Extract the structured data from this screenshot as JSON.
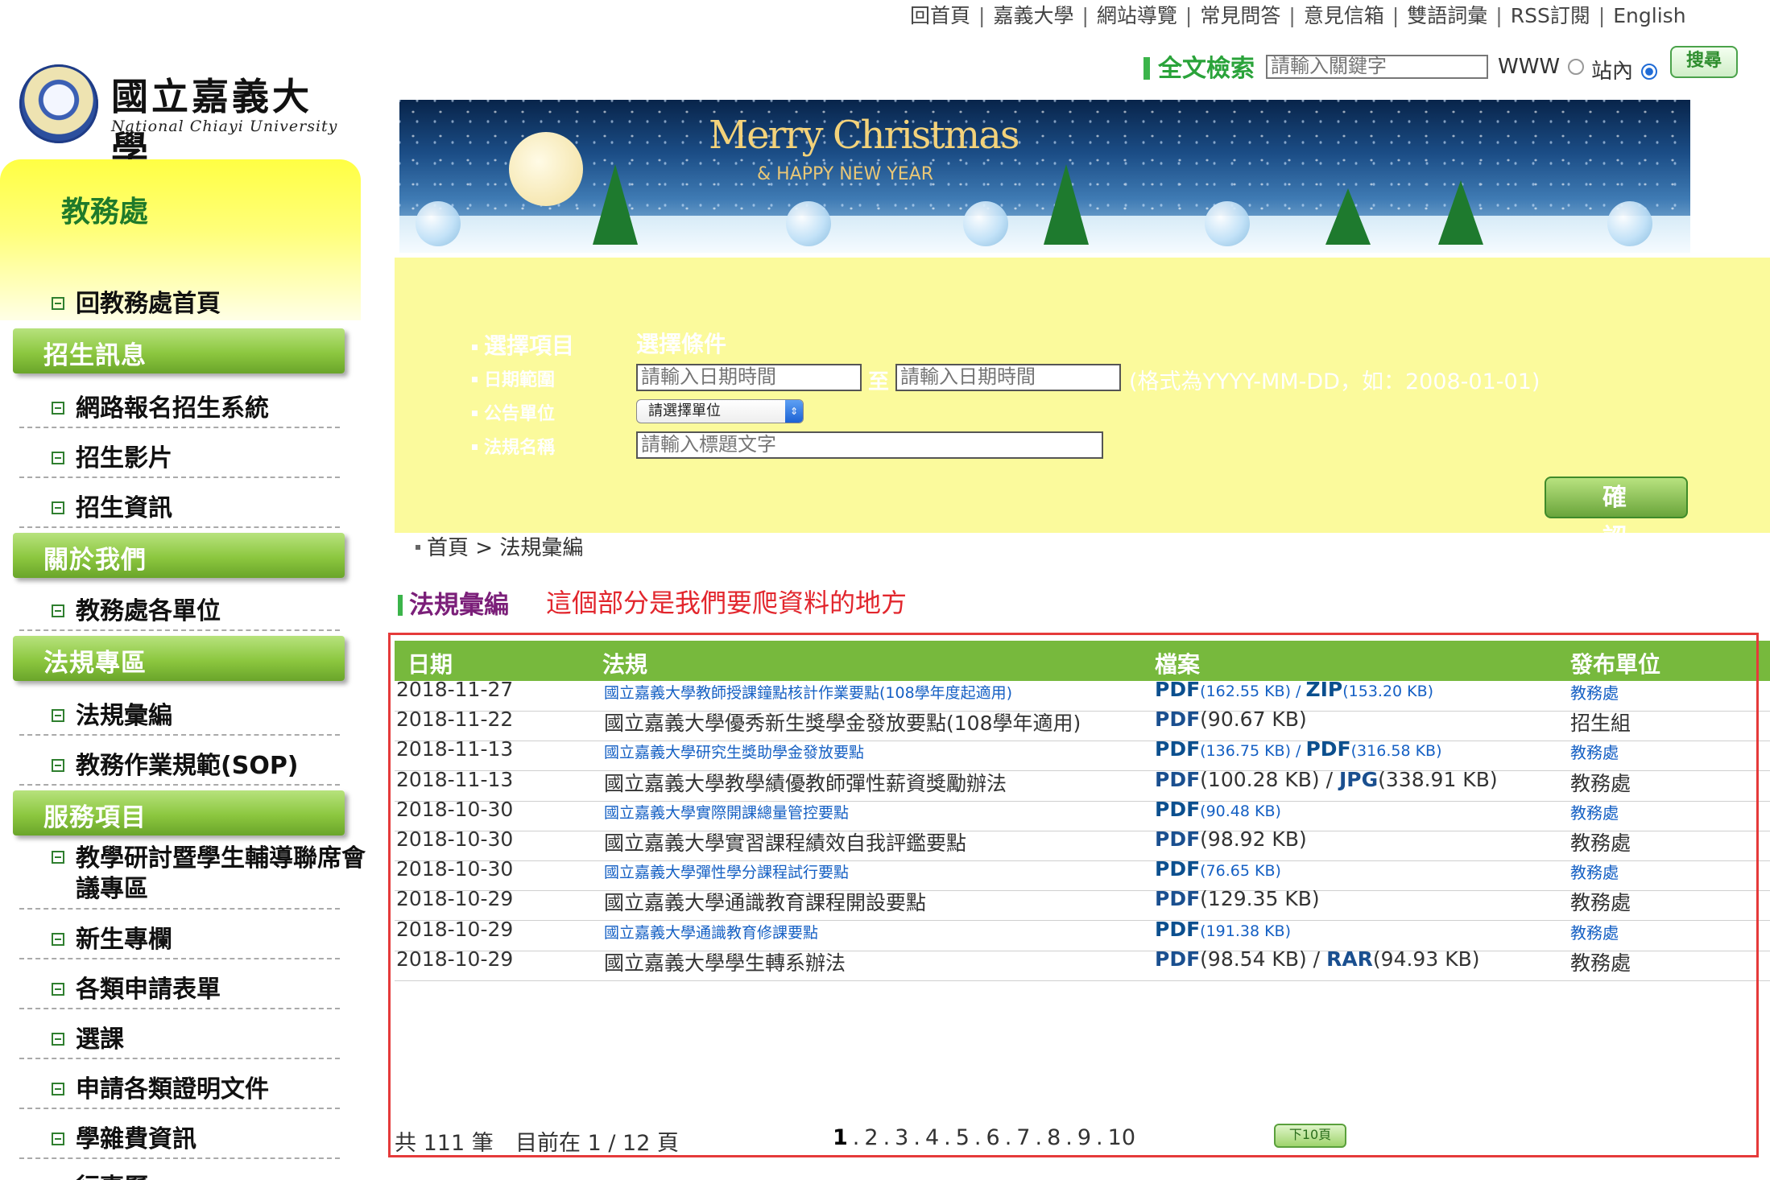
{
  "topnav": {
    "items": [
      "回首頁",
      "嘉義大學",
      "網站導覽",
      "常見問答",
      "意見信箱",
      "雙語詞彙",
      "RSS訂閱",
      "English"
    ]
  },
  "logo": {
    "cn": "國立嘉義大學",
    "en": "National Chiayi University"
  },
  "search": {
    "label": "全文檢索",
    "placeholder": "請輸入關鍵字",
    "scope_www": "WWW",
    "scope_site": "站內",
    "selected_scope": "站內",
    "button": "搜尋"
  },
  "banner": {
    "title": "Merry Christmas",
    "subtitle": "& HAPPY NEW YEAR"
  },
  "sidebar": {
    "title": "教務處",
    "home_link": "回教務處首頁",
    "sections": [
      {
        "category": "招生訊息",
        "items": [
          "網路報名招生系統",
          "招生影片",
          "招生資訊"
        ]
      },
      {
        "category": "關於我們",
        "items": [
          "教務處各單位"
        ]
      },
      {
        "category": "法規專區",
        "items": [
          "法規彙編",
          "教務作業規範(SOP)"
        ]
      },
      {
        "category": "服務項目",
        "items": [
          "教學研討暨學生輔導聯席會議專區",
          "新生專欄",
          "各類申請表單",
          "選課",
          "申請各類證明文件",
          "學雜費資訊",
          "行事曆"
        ]
      }
    ]
  },
  "filter": {
    "head_item": "選擇項目",
    "head_cond": "選擇條件",
    "date_label": "日期範圍",
    "date_from_placeholder": "請輸入日期時間",
    "date_to_sep": "至",
    "date_to_placeholder": "請輸入日期時間",
    "date_hint": "(格式為YYYY-MM-DD，如：2008-01-01)",
    "unit_label": "公告單位",
    "unit_select": "請選擇單位",
    "title_label": "法規名稱",
    "title_placeholder": "請輸入標題文字",
    "confirm": "確認"
  },
  "breadcrumb": "首頁 > 法規彙編",
  "section_title": "法規彙編",
  "annotation": "這個部分是我們要爬資料的地方",
  "table": {
    "headers": [
      "日期",
      "法規",
      "檔案",
      "發布單位"
    ],
    "rows": [
      {
        "date": "2018-11-27",
        "title": "國立嘉義大學教師授課鐘點核計作業要點(108學年度起適用)",
        "files": [
          {
            "type": "PDF",
            "size": "(162.55 KB)"
          },
          {
            "type": "ZIP",
            "size": "(153.20 KB)"
          }
        ],
        "unit": "教務處",
        "link": true
      },
      {
        "date": "2018-11-22",
        "title": "國立嘉義大學優秀新生獎學金發放要點(108學年適用)",
        "files": [
          {
            "type": "PDF",
            "size": "(90.67 KB)"
          }
        ],
        "unit": "招生組",
        "link": false
      },
      {
        "date": "2018-11-13",
        "title": "國立嘉義大學研究生獎助學金發放要點",
        "files": [
          {
            "type": "PDF",
            "size": "(136.75 KB)"
          },
          {
            "type": "PDF",
            "size": "(316.58 KB)"
          }
        ],
        "unit": "教務處",
        "link": true
      },
      {
        "date": "2018-11-13",
        "title": "國立嘉義大學教學績優教師彈性薪資獎勵辦法",
        "files": [
          {
            "type": "PDF",
            "size": "(100.28 KB)"
          },
          {
            "type": "JPG",
            "size": "(338.91 KB)"
          }
        ],
        "unit": "教務處",
        "link": false
      },
      {
        "date": "2018-10-30",
        "title": "國立嘉義大學實際開課總量管控要點",
        "files": [
          {
            "type": "PDF",
            "size": "(90.48 KB)"
          }
        ],
        "unit": "教務處",
        "link": true
      },
      {
        "date": "2018-10-30",
        "title": "國立嘉義大學實習課程績效自我評鑑要點",
        "files": [
          {
            "type": "PDF",
            "size": "(98.92 KB)"
          }
        ],
        "unit": "教務處",
        "link": false
      },
      {
        "date": "2018-10-30",
        "title": "國立嘉義大學彈性學分課程試行要點",
        "files": [
          {
            "type": "PDF",
            "size": "(76.65 KB)"
          }
        ],
        "unit": "教務處",
        "link": true
      },
      {
        "date": "2018-10-29",
        "title": "國立嘉義大學通識教育課程開設要點",
        "files": [
          {
            "type": "PDF",
            "size": "(129.35 KB)"
          }
        ],
        "unit": "教務處",
        "link": false
      },
      {
        "date": "2018-10-29",
        "title": "國立嘉義大學通識教育修課要點",
        "files": [
          {
            "type": "PDF",
            "size": "(191.38 KB)"
          }
        ],
        "unit": "教務處",
        "link": true
      },
      {
        "date": "2018-10-29",
        "title": "國立嘉義大學學生轉系辦法",
        "files": [
          {
            "type": "PDF",
            "size": "(98.54 KB)"
          },
          {
            "type": "RAR",
            "size": "(94.93 KB)"
          }
        ],
        "unit": "教務處",
        "link": false
      }
    ]
  },
  "pager": {
    "total": "共 111 筆",
    "current": "目前在 1 / 12 頁",
    "pages": [
      "1",
      "2",
      "3",
      "4",
      "5",
      "6",
      "7",
      "8",
      "9",
      "10"
    ],
    "current_page": "1",
    "next10": "下10頁"
  }
}
